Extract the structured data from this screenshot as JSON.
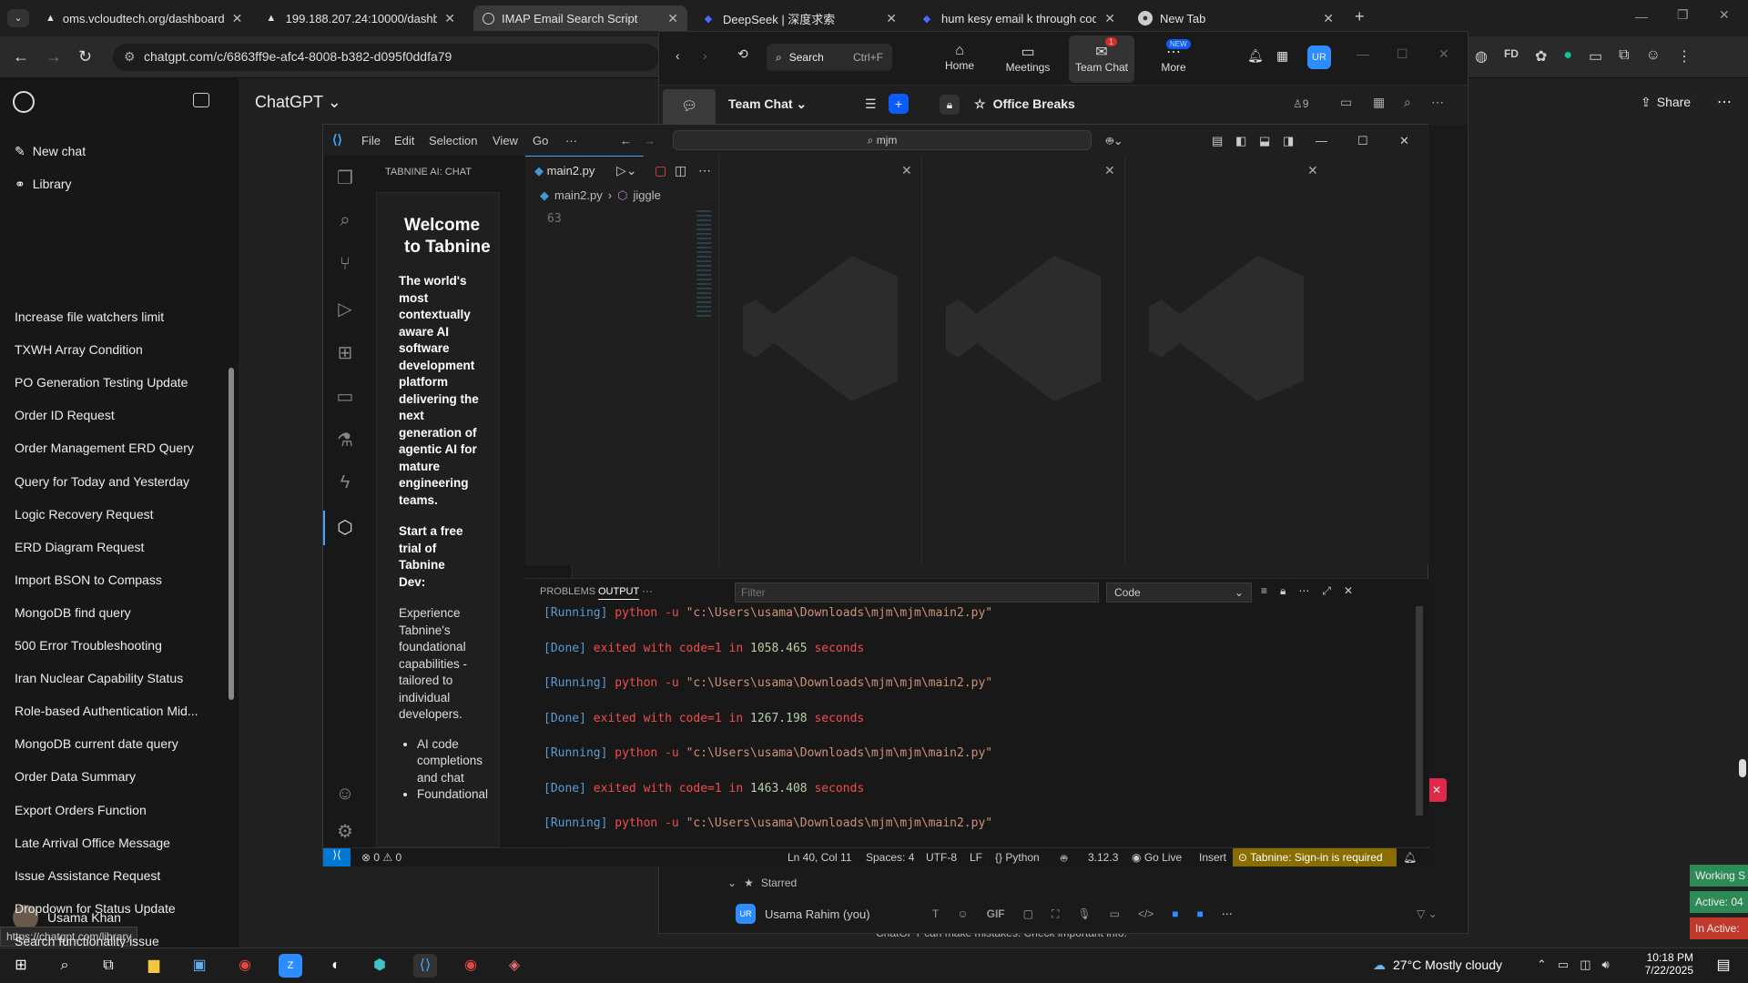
{
  "browser": {
    "tabs": [
      {
        "title": "oms.vcloudtech.org/dashboard"
      },
      {
        "title": "199.188.207.24:10000/dashboar"
      },
      {
        "title": "IMAP Email Search Script"
      },
      {
        "title": "DeepSeek | 深度求索"
      },
      {
        "title": "hum kesy email k through code"
      },
      {
        "title": "New Tab"
      }
    ],
    "url": "chatgpt.com/c/6863ff9e-afc4-8008-b382-d095f0ddfa79",
    "status_url": "https://chatgpt.com/library"
  },
  "chatgpt": {
    "brand": "ChatGPT",
    "new_chat": "New chat",
    "library": "Library",
    "share": "Share",
    "history": [
      "Increase file watchers limit",
      "TXWH Array Condition",
      "PO Generation Testing Update",
      "Order ID Request",
      "Order Management ERD Query",
      "Query for Today and Yesterday",
      "Logic Recovery Request",
      "ERD Diagram Request",
      "Import BSON to Compass",
      "MongoDB find query",
      "500 Error Troubleshooting",
      "Iran Nuclear Capability Status",
      "Role-based Authentication Mid...",
      "MongoDB current date query",
      "Order Data Summary",
      "Export Orders Function",
      "Late Arrival Office Message",
      "Issue Assistance Request",
      "Dropdown for Status Update",
      "Search functionality issue"
    ],
    "user": "Usama Khan",
    "disclaimer": "ChatGPT can make mistakes. Check important info."
  },
  "zoom": {
    "search_label": "Search",
    "search_shortcut": "Ctrl+F",
    "nav": [
      {
        "label": "Home"
      },
      {
        "label": "Meetings"
      },
      {
        "label": "Team Chat",
        "badge": "1"
      },
      {
        "label": "More",
        "badge": "NEW"
      }
    ],
    "avatar": "UR",
    "team_chat_title": "Team Chat",
    "channel": "Office Breaks",
    "members": "9",
    "starred": "Starred",
    "contact": "Usama Rahim (you)",
    "gif": "GIF",
    "status_badges": [
      "Working S",
      "Active: 04",
      "In Active:"
    ]
  },
  "vscode": {
    "menu": [
      "File",
      "Edit",
      "Selection",
      "View",
      "Go",
      "···"
    ],
    "search_text": "mjm",
    "sidebar_title": "TABNINE AI: CHAT",
    "welcome_title": "Welcome to Tabnine",
    "intro": "The world's most contextually aware AI software development platform delivering the next generation of agentic AI for mature engineering teams.",
    "trial_heading": "Start a free trial of Tabnine Dev:",
    "trial_text": "Experience Tabnine's foundational capabilities - tailored to individual developers.",
    "bullets": [
      "AI code completions and chat",
      "Foundational"
    ],
    "tab": "main2.py",
    "breadcrumb": [
      "main2.py",
      "jiggle"
    ],
    "line_number": "63",
    "panel_tabs": [
      "PROBLEMS",
      "OUTPUT",
      "···"
    ],
    "filter_placeholder": "Filter",
    "output_channel": "Code",
    "output_lines": [
      {
        "kind": "running",
        "text": "[Running] python -u \"c:\\Users\\usama\\Downloads\\mjm\\mjm\\main2.py\""
      },
      {
        "kind": "done",
        "text": "[Done] exited with code=1 in 1058.465 seconds"
      },
      {
        "kind": "running",
        "text": "[Running] python -u \"c:\\Users\\usama\\Downloads\\mjm\\mjm\\main2.py\""
      },
      {
        "kind": "done",
        "text": "[Done] exited with code=1 in 1267.198 seconds"
      },
      {
        "kind": "running",
        "text": "[Running] python -u \"c:\\Users\\usama\\Downloads\\mjm\\mjm\\main2.py\""
      },
      {
        "kind": "done",
        "text": "[Done] exited with code=1 in 1463.408 seconds"
      },
      {
        "kind": "running",
        "text": "[Running] python -u \"c:\\Users\\usama\\Downloads\\mjm\\mjm\\main2.py\""
      }
    ],
    "status": {
      "errors": "0",
      "warnings": "0",
      "position": "Ln 40, Col 11",
      "spaces": "Spaces: 4",
      "encoding": "UTF-8",
      "eol": "LF",
      "language": "Python",
      "version": "3.12.3",
      "golive": "Go Live",
      "mode": "Insert",
      "tabnine": "Tabnine: Sign-in is required"
    }
  },
  "taskbar": {
    "weather": "27°C  Mostly cloudy",
    "time": "10:18 PM",
    "date": "7/22/2025"
  }
}
